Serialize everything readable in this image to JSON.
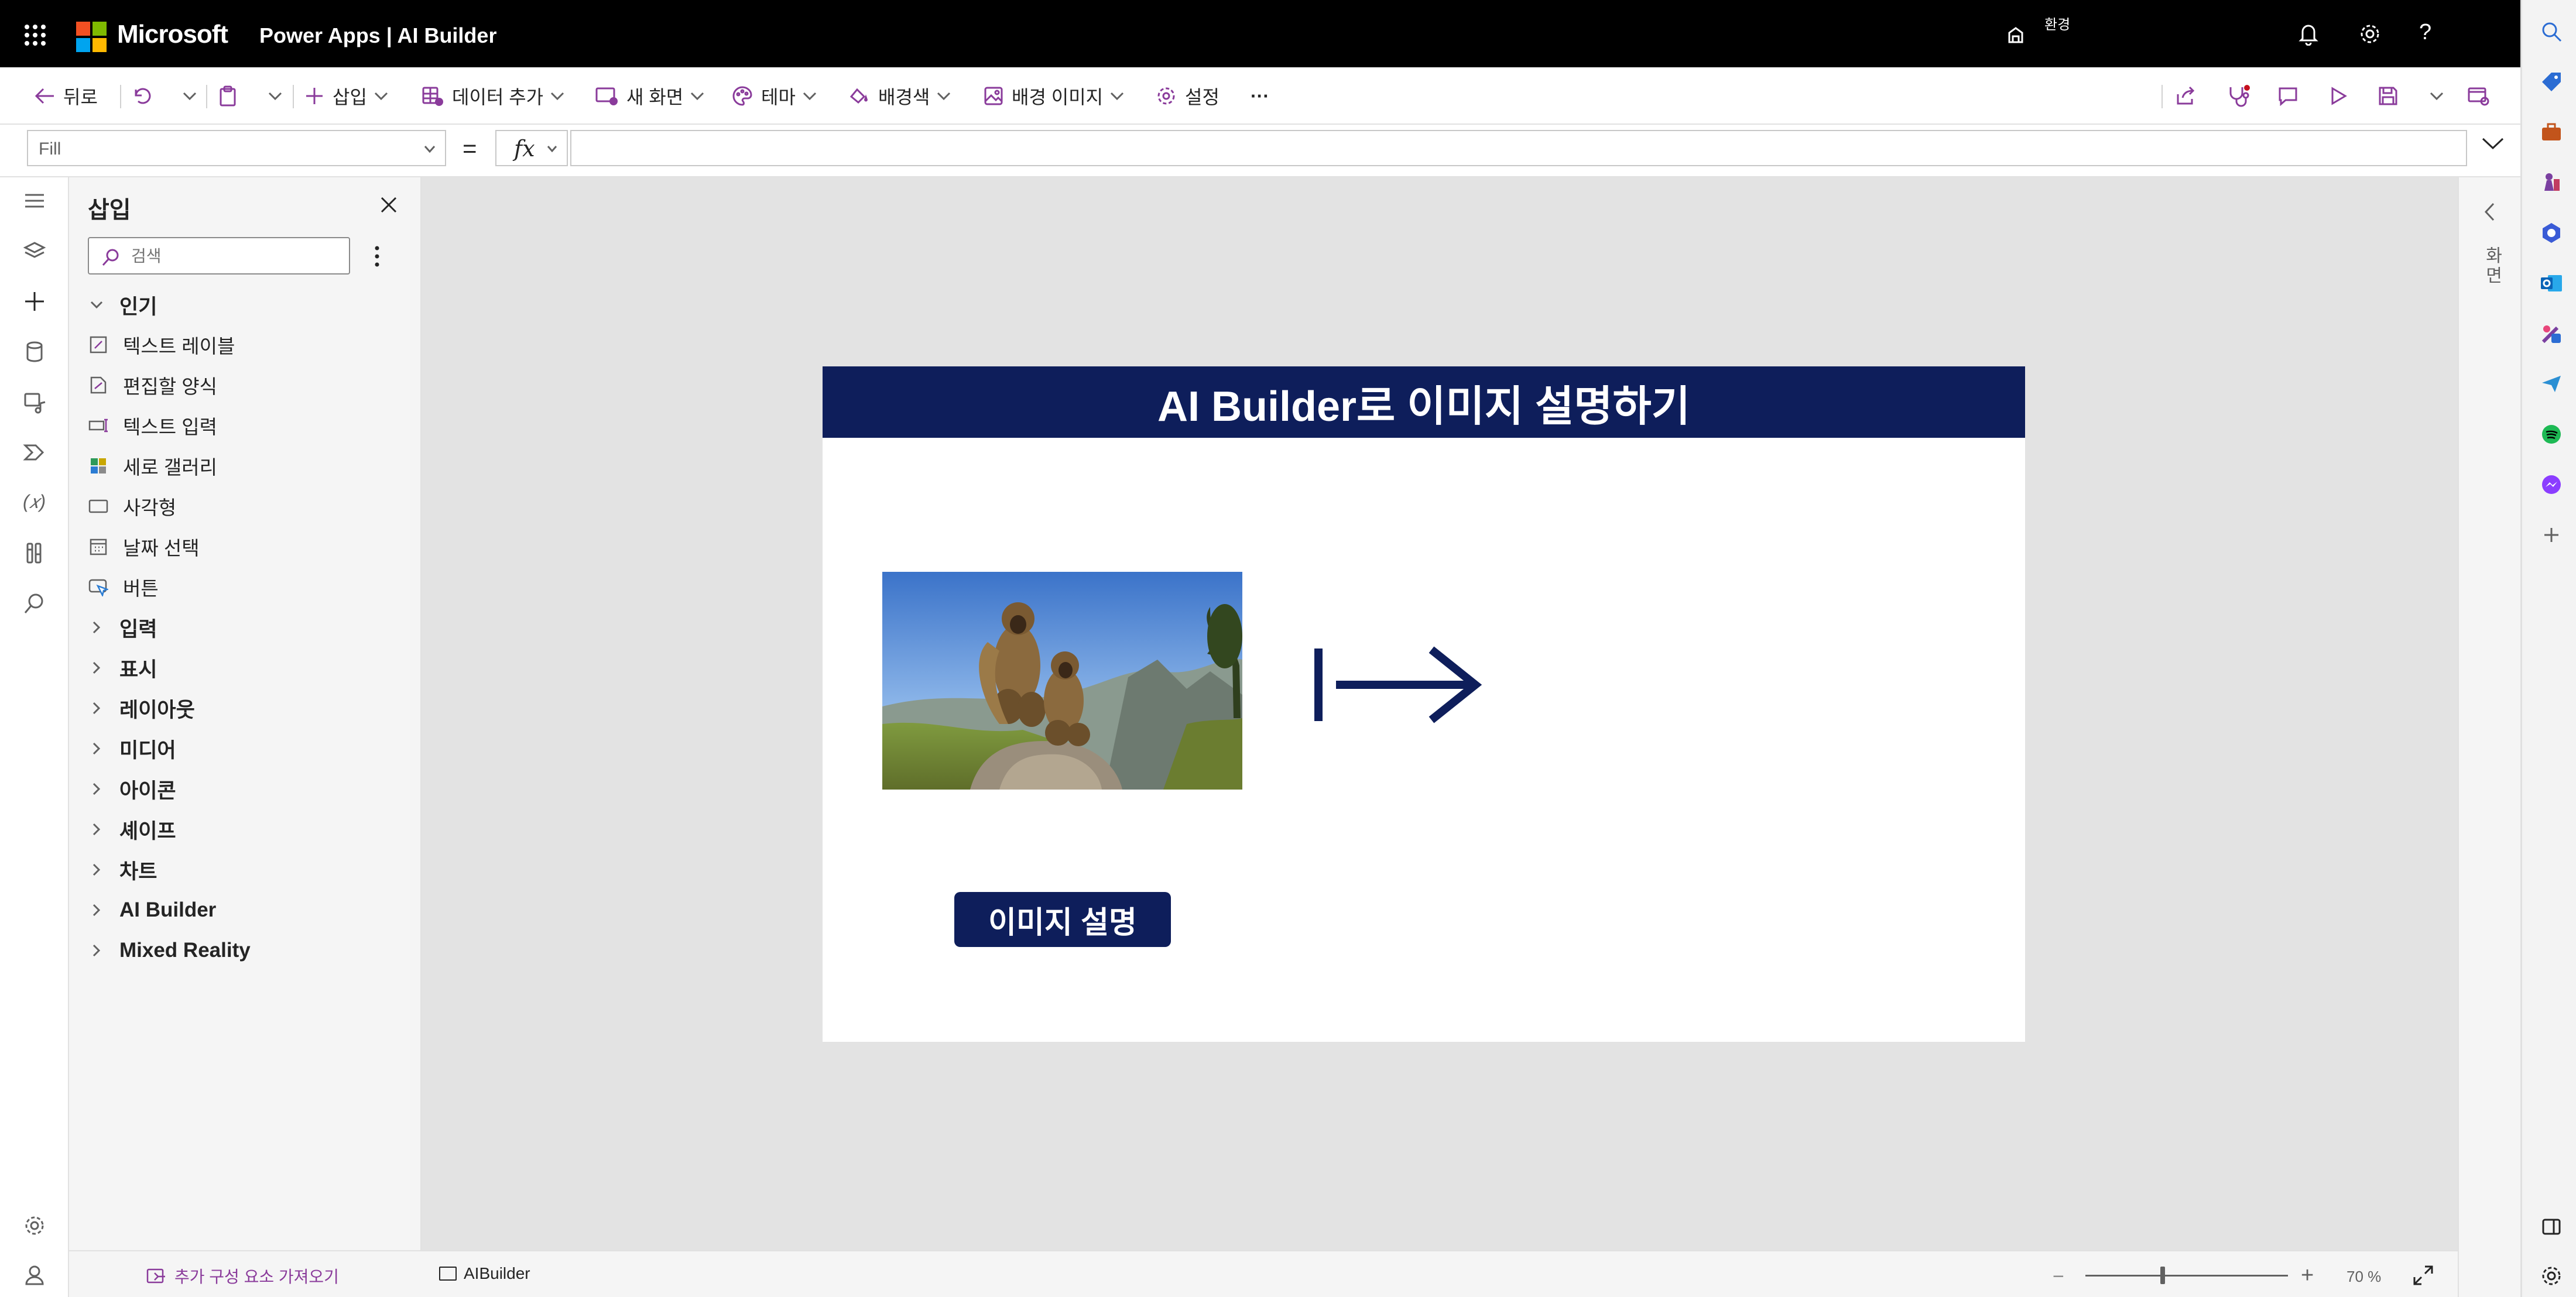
{
  "topbar": {
    "brand": "Microsoft",
    "app_title": "Power Apps  |  AI Builder",
    "environment_label": "환경"
  },
  "commandbar": {
    "back": "뒤로",
    "insert": "삽입",
    "add_data": "데이터 추가",
    "new_screen": "새 화면",
    "theme": "테마",
    "background_color": "배경색",
    "background_image": "배경 이미지",
    "settings": "설정",
    "more": "···"
  },
  "formulabar": {
    "property": "Fill",
    "equals": "=",
    "fx": "fx",
    "formula": ""
  },
  "insert_panel": {
    "title": "삽입",
    "search_placeholder": "검색",
    "popular_label": "인기",
    "popular_items": [
      "텍스트 레이블",
      "편집할 양식",
      "텍스트 입력",
      "세로 갤러리",
      "사각형",
      "날짜 선택",
      "버튼"
    ],
    "categories": [
      "입력",
      "표시",
      "레이아웃",
      "미디어",
      "아이콘",
      "셰이프",
      "차트",
      "AI Builder",
      "Mixed Reality"
    ],
    "footer_link": "추가 구성 요소 가져오기"
  },
  "canvas": {
    "header_title": "AI Builder로 이미지 설명하기",
    "button_label": "이미지 설명"
  },
  "right_pane": {
    "label": "화면"
  },
  "statusbar": {
    "screen_name": "AIBuilder",
    "zoom_minus": "−",
    "zoom_plus": "+",
    "zoom_level": "70 %",
    "zoom_fraction": 0.7
  },
  "colors": {
    "header_navy": "#0e1e5b",
    "topbar": "#000000",
    "accent_purple": "#8a3b9b"
  }
}
